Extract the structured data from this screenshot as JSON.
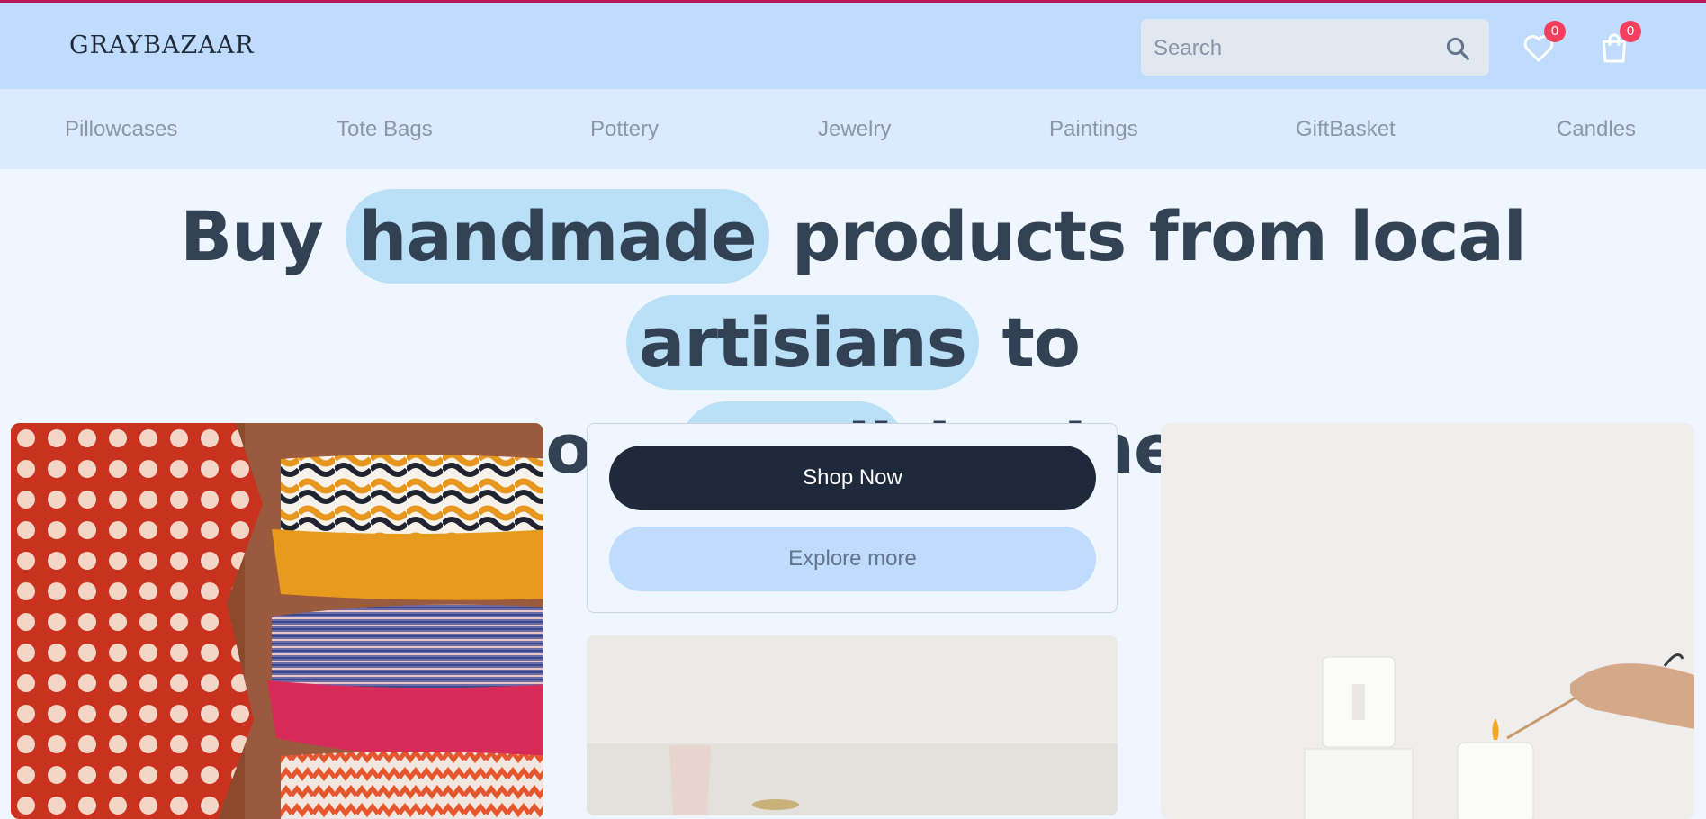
{
  "header": {
    "logo": "GRAYBAZAAR",
    "search": {
      "placeholder": "Search",
      "value": ""
    },
    "wishlist_count": "0",
    "cart_count": "0"
  },
  "nav": {
    "items": [
      "Pillowcases",
      "Tote Bags",
      "Pottery",
      "Jewelry",
      "Paintings",
      "GiftBasket",
      "Candles"
    ]
  },
  "hero": {
    "parts": [
      "Buy ",
      "handmade",
      " products from local ",
      "artisians",
      " to",
      "support ",
      "small",
      " businesses"
    ]
  },
  "cta": {
    "shop_now": "Shop Now",
    "explore_more": "Explore more"
  },
  "colors": {
    "header_bg": "#bfdbfe",
    "nav_bg": "#dbeafe",
    "page_bg": "#eff6ff",
    "accent_line": "#be185d",
    "primary_button": "#1e293b",
    "highlight": "#bae0f7",
    "badge": "#f43f5e"
  },
  "icons": {
    "search": "search-icon",
    "wishlist": "heart-icon",
    "cart": "shopping-bag-icon"
  }
}
